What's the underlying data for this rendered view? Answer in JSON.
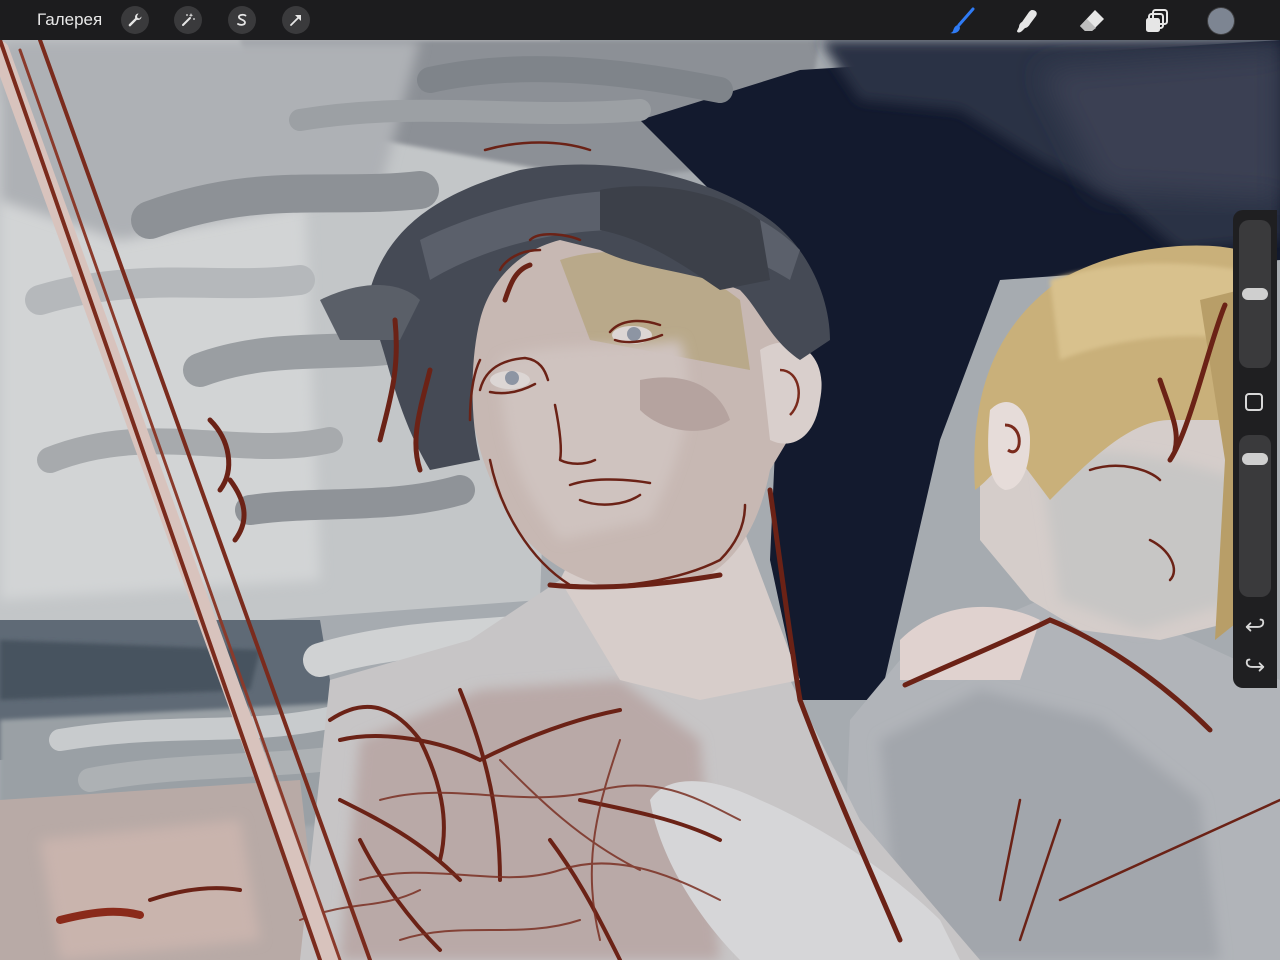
{
  "toolbar": {
    "gallery_label": "Галерея",
    "left_tools": [
      "wrench-icon",
      "magic-wand-icon",
      "selection-s-icon",
      "transform-arrow-icon"
    ],
    "right_tools": [
      "brush-icon",
      "smudge-icon",
      "eraser-icon",
      "layers-icon"
    ],
    "active_tool": "brush-icon",
    "active_color": "#7d8592",
    "accent_color": "#2f7bf5"
  },
  "sidebar": {
    "brush_size_level": 0.5,
    "opacity_level": 0.9,
    "icons": [
      "modify-square-icon",
      "undo-icon",
      "redo-icon"
    ]
  }
}
